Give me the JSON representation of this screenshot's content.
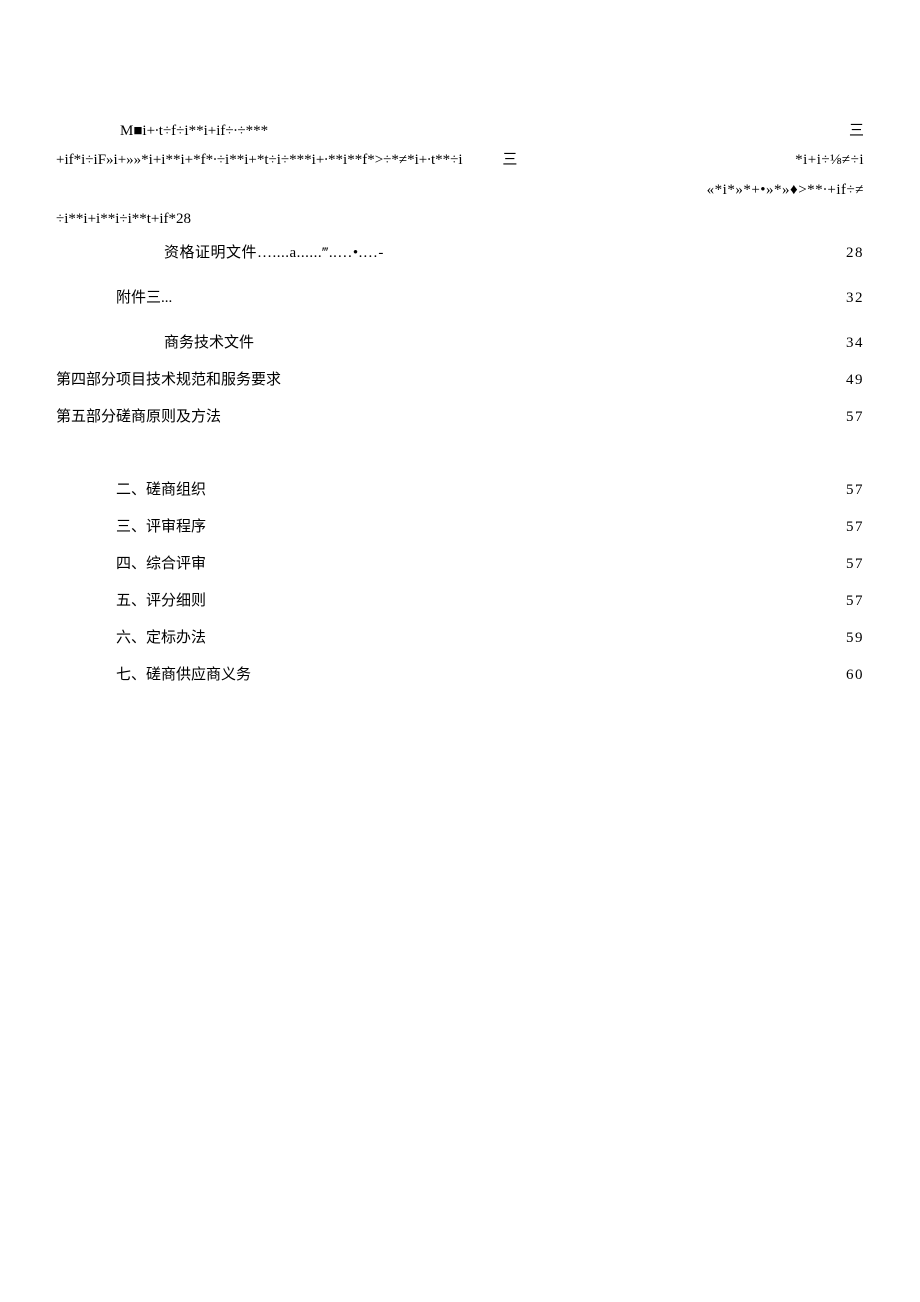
{
  "garble": {
    "line1_left": "M■i+∙t÷f÷i**i+if÷∙÷***",
    "line1_right": "三",
    "line2_left": "+if*i÷iF»i+»»*i+i**i+*f*∙÷i**i+*t÷i÷***i+∙**i**f*>÷*≠*i+∙t**÷i",
    "line2_mid": "三",
    "line2_right": "*i+i÷⅛≠÷i",
    "line3_right": "«*i*»*+•»*»♦>**∙+if÷≠",
    "line4": "÷i**i+i**i÷i**t+if*28"
  },
  "toc": {
    "zige": {
      "label": "资格证明文件…....a......‴..…•.…-",
      "page": "28"
    },
    "fujian3": {
      "label": "附件三...",
      "page": "32"
    },
    "shangwu": {
      "label": "商务技术文件",
      "page": "34"
    },
    "part4": {
      "label": "第四部分项目技术规范和服务要求",
      "page": "49"
    },
    "part5": {
      "label": "第五部分磋商原则及方法",
      "page": "57"
    },
    "s2": {
      "label": "二、磋商组织",
      "page": "57"
    },
    "s3": {
      "label": "三、评审程序",
      "page": "57"
    },
    "s4": {
      "label": "四、综合评审",
      "page": "57"
    },
    "s5": {
      "label": "五、评分细则",
      "page": "57"
    },
    "s6": {
      "label": "六、定标办法",
      "page": "59"
    },
    "s7": {
      "label": "七、磋商供应商义务",
      "page": "60"
    }
  }
}
